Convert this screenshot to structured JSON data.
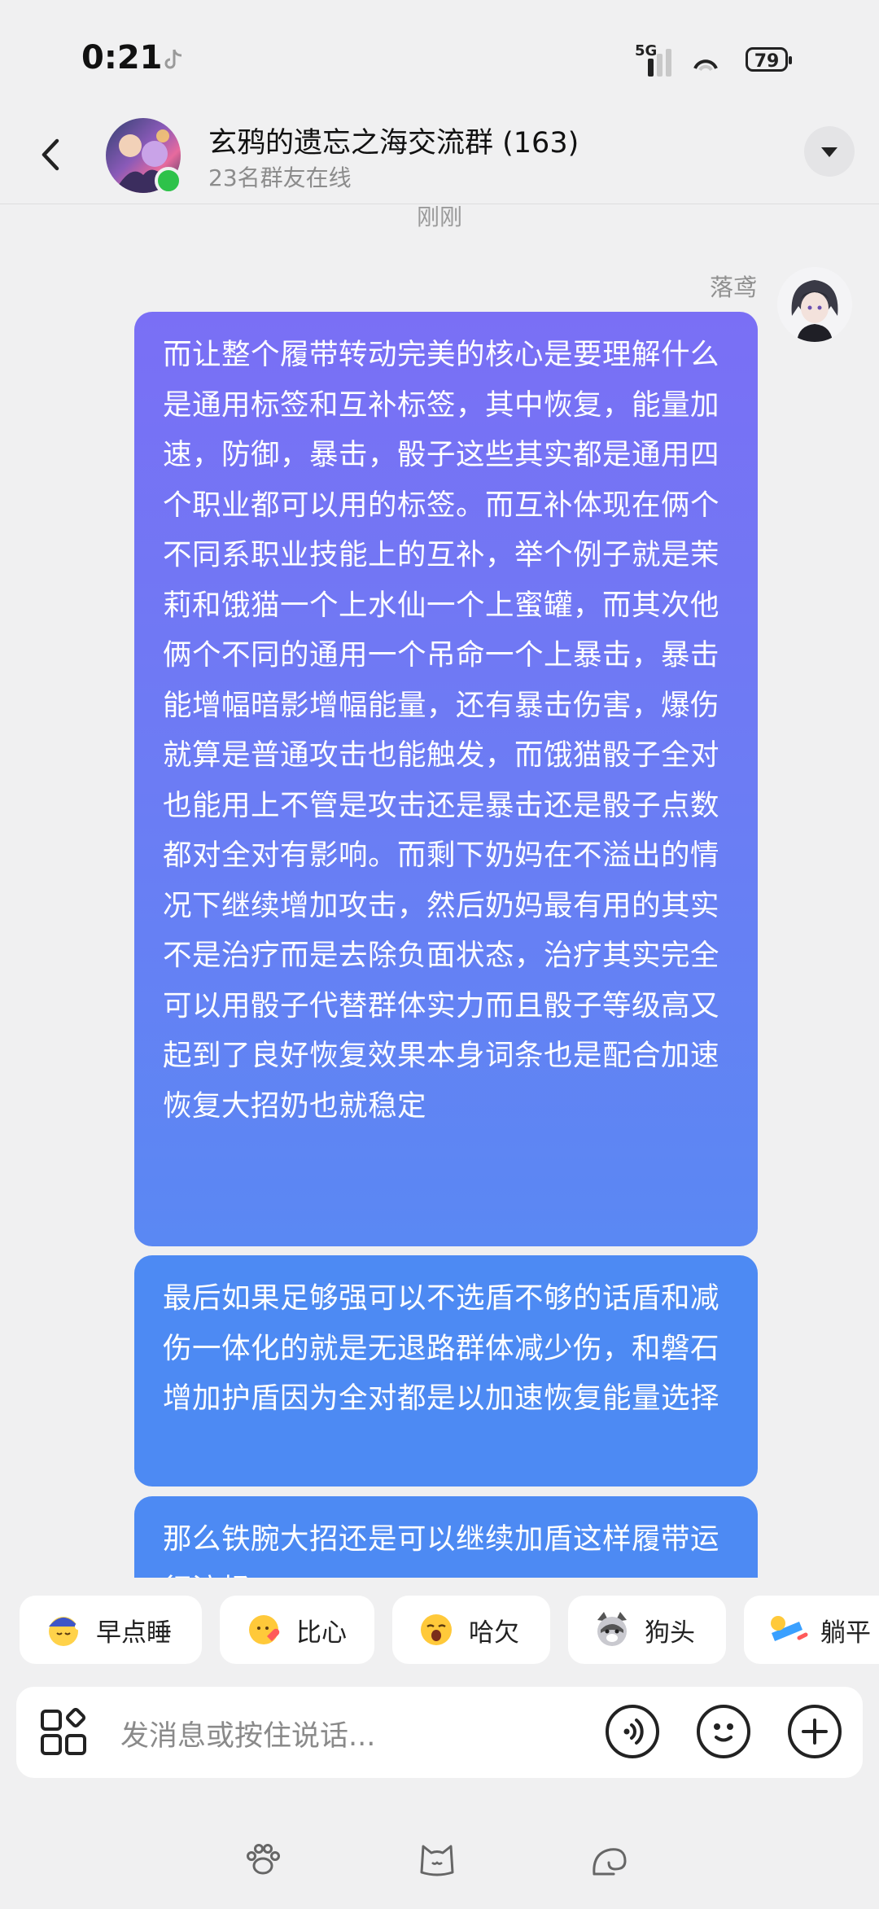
{
  "status_bar": {
    "time": "0:21",
    "network": "5G",
    "battery": "79"
  },
  "header": {
    "title": "玄鸦的遗忘之海交流群 (163)",
    "subtitle": "23名群友在线"
  },
  "messages": {
    "timestamp": "刚刚",
    "sender": "落鸢",
    "bubble1": "而让整个履带转动完美的核心是要理解什么是通用标签和互补标签，其中恢复，能量加速，防御，暴击，骰子这些其实都是通用四个职业都可以用的标签。而互补体现在俩个不同系职业技能上的互补，举个例子就是茉莉和饿猫一个上水仙一个上蜜罐，而其次他俩个不同的通用一个吊命一个上暴击，暴击能增幅暗影增幅能量，还有暴击伤害，爆伤就算是普通攻击也能触发，而饿猫骰子全对也能用上不管是攻击还是暴击还是骰子点数都对全对有影响。而剩下奶妈在不溢出的情况下继续增加攻击，然后奶妈最有用的其实不是治疗而是去除负面状态，治疗其实完全可以用骰子代替群体实力而且骰子等级高又起到了良好恢复效果本身词条也是配合加速恢复大招奶也就稳定",
    "bubble2": "最后如果足够强可以不选盾不够的话盾和减伤一体化的就是无退路群体减少伤，和磐石增加护盾因为全对都是以加速恢复能量选择",
    "bubble3": "那么铁腕大招还是可以继续加盾这样履带运行流畅"
  },
  "quick_replies": [
    {
      "label": "早点睡",
      "icon": "sleep-emoji-icon"
    },
    {
      "label": "比心",
      "icon": "heart-hands-emoji-icon"
    },
    {
      "label": "哈欠",
      "icon": "yawn-emoji-icon"
    },
    {
      "label": "狗头",
      "icon": "dog-head-emoji-icon"
    },
    {
      "label": "躺平",
      "icon": "lie-flat-emoji-icon"
    }
  ],
  "input": {
    "placeholder": "发消息或按住说话..."
  },
  "colors": {
    "bubble_top": "#7a6ff5",
    "bubble_bottom": "#5a88f3",
    "bubble_solid": "#4d8af3",
    "online": "#2ec24a",
    "background": "#f0f0f1"
  }
}
